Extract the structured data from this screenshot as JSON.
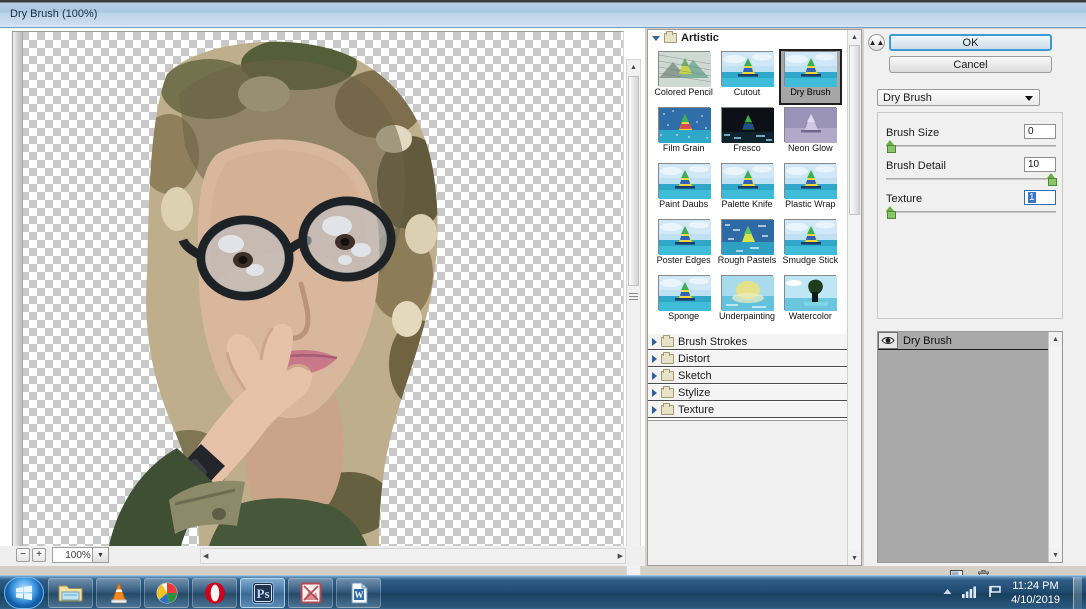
{
  "window": {
    "title": "Dry Brush (100%)"
  },
  "canvas": {
    "zoom_label": "100%",
    "zoom_out_label": "−",
    "zoom_in_label": "+",
    "image_alt": "portrait of a woman wearing glasses and a camouflage headscarf with dry brush filter applied"
  },
  "gallery": {
    "expanded_category": "Artistic",
    "selected_filter": "Dry Brush",
    "filters": [
      {
        "label": "Colored Pencil"
      },
      {
        "label": "Cutout"
      },
      {
        "label": "Dry Brush"
      },
      {
        "label": "Film Grain"
      },
      {
        "label": "Fresco"
      },
      {
        "label": "Neon Glow"
      },
      {
        "label": "Paint Daubs"
      },
      {
        "label": "Palette Knife"
      },
      {
        "label": "Plastic Wrap"
      },
      {
        "label": "Poster Edges"
      },
      {
        "label": "Rough Pastels"
      },
      {
        "label": "Smudge Stick"
      },
      {
        "label": "Sponge"
      },
      {
        "label": "Underpainting"
      },
      {
        "label": "Watercolor"
      }
    ],
    "categories": [
      {
        "label": "Brush Strokes"
      },
      {
        "label": "Distort"
      },
      {
        "label": "Sketch"
      },
      {
        "label": "Stylize"
      },
      {
        "label": "Texture"
      }
    ]
  },
  "settings": {
    "ok_label": "OK",
    "cancel_label": "Cancel",
    "preset_value": "Dry Brush",
    "sliders": [
      {
        "label": "Brush Size",
        "value": "0",
        "percent": 0
      },
      {
        "label": "Brush Detail",
        "value": "10",
        "percent": 100
      },
      {
        "label": "Texture",
        "value": "1",
        "percent": 0
      }
    ]
  },
  "effect_layers": {
    "items": [
      {
        "label": "Dry Brush",
        "visible": true
      }
    ]
  },
  "taskbar": {
    "items": [
      {
        "name": "windows-explorer",
        "active": false
      },
      {
        "name": "vlc-media-player",
        "active": false
      },
      {
        "name": "paint-net",
        "active": false
      },
      {
        "name": "opera-browser",
        "active": false
      },
      {
        "name": "adobe-photoshop",
        "active": true,
        "label": "Ps"
      },
      {
        "name": "picture-manager",
        "active": false
      },
      {
        "name": "microsoft-word",
        "active": false,
        "label": "W"
      }
    ],
    "clock": {
      "time": "11:24 PM",
      "date": "4/10/2019"
    }
  },
  "colors": {
    "accent": "#3c9ad5",
    "titlebar": "#a8c6e2",
    "taskbar": "#1f4a70",
    "slider_knob": "#8cc46a",
    "selection": "#3b76c4"
  }
}
